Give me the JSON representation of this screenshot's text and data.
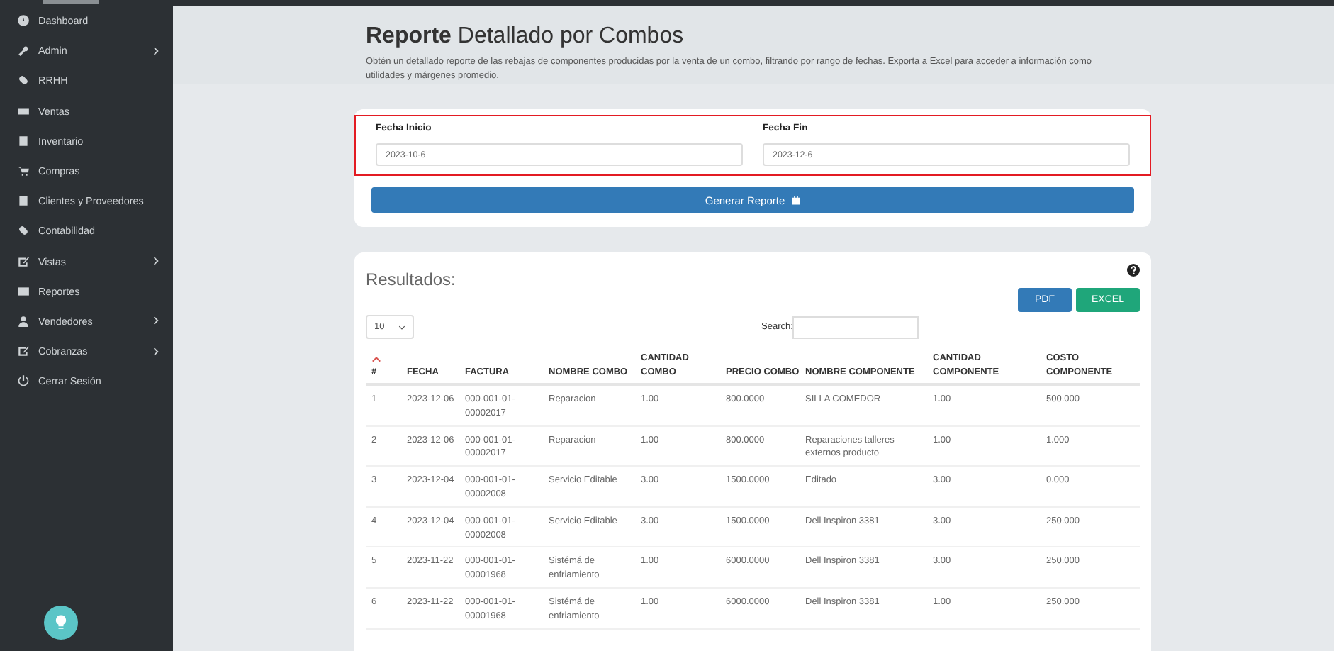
{
  "sidebar": {
    "items": [
      {
        "label": "Dashboard",
        "has_submenu": false
      },
      {
        "label": "Admin",
        "has_submenu": true
      },
      {
        "label": "RRHH",
        "has_submenu": false
      },
      {
        "label": "Ventas",
        "has_submenu": false
      },
      {
        "label": "Inventario",
        "has_submenu": false
      },
      {
        "label": "Compras",
        "has_submenu": false
      },
      {
        "label": "Clientes y Proveedores",
        "has_submenu": false
      },
      {
        "label": "Contabilidad",
        "has_submenu": false
      },
      {
        "label": "Vistas",
        "has_submenu": true
      },
      {
        "label": "Reportes",
        "has_submenu": false
      },
      {
        "label": "Vendedores",
        "has_submenu": true
      },
      {
        "label": "Cobranzas",
        "has_submenu": true
      },
      {
        "label": "Cerrar Sesión",
        "has_submenu": false
      }
    ]
  },
  "header": {
    "title_bold": "Reporte",
    "title_rest": "Detallado por Combos",
    "description": "Obtén un detallado reporte de las rebajas de componentes producidas por la venta de un combo, filtrando por rango de fechas. Exporta a Excel para acceder a información como utilidades y márgenes promedio."
  },
  "filters": {
    "fields": [
      {
        "label": "Fecha Inicio",
        "value": "2023-10-6"
      },
      {
        "label": "Fecha Fin",
        "value": "2023-12-6"
      }
    ],
    "generate_button": "Generar Reporte"
  },
  "results": {
    "title": "Resultados:",
    "buttons": [
      "PDF",
      "EXCEL"
    ],
    "page_size": "10",
    "search_label": "Search:",
    "table": {
      "columns": [
        {
          "label": "#",
          "sorted": true
        },
        {
          "label": "FECHA",
          "sorted": false
        },
        {
          "label": "FACTURA",
          "sorted": false
        },
        {
          "label": "NOMBRE COMBO",
          "sorted": false
        },
        {
          "label": "CANTIDAD COMBO",
          "sorted": false
        },
        {
          "label": "PRECIO COMBO",
          "sorted": false
        },
        {
          "label": "NOMBRE COMPONENTE",
          "sorted": false
        },
        {
          "label": "CANTIDAD COMPONENTE",
          "sorted": false
        },
        {
          "label": "COSTO COMPONENTE",
          "sorted": false
        }
      ],
      "rows": [
        [
          "1",
          "2023-12-06",
          "000-001-01-00002017",
          "Reparacion",
          "1.00",
          "800.0000",
          "SILLA COMEDOR",
          "1.00",
          "500.000"
        ],
        [
          "2",
          "2023-12-06",
          "000-001-01-00002017",
          "Reparacion",
          "1.00",
          "800.0000",
          "Reparaciones talleres externos producto",
          "1.00",
          "1.000"
        ],
        [
          "3",
          "2023-12-04",
          "000-001-01-00002008",
          "Servicio Editable",
          "3.00",
          "1500.0000",
          "Editado",
          "3.00",
          "0.000"
        ],
        [
          "4",
          "2023-12-04",
          "000-001-01-00002008",
          "Servicio Editable",
          "3.00",
          "1500.0000",
          "Dell Inspiron 3381",
          "3.00",
          "250.000"
        ],
        [
          "5",
          "2023-11-22",
          "000-001-01-00001968",
          "Sistémá de enfriamiento",
          "1.00",
          "6000.0000",
          "Dell Inspiron 3381",
          "3.00",
          "250.000"
        ],
        [
          "6",
          "2023-11-22",
          "000-001-01-00001968",
          "Sistémá de enfriamiento",
          "1.00",
          "6000.0000",
          "Dell Inspiron 3381",
          "1.00",
          "250.000"
        ]
      ]
    }
  }
}
